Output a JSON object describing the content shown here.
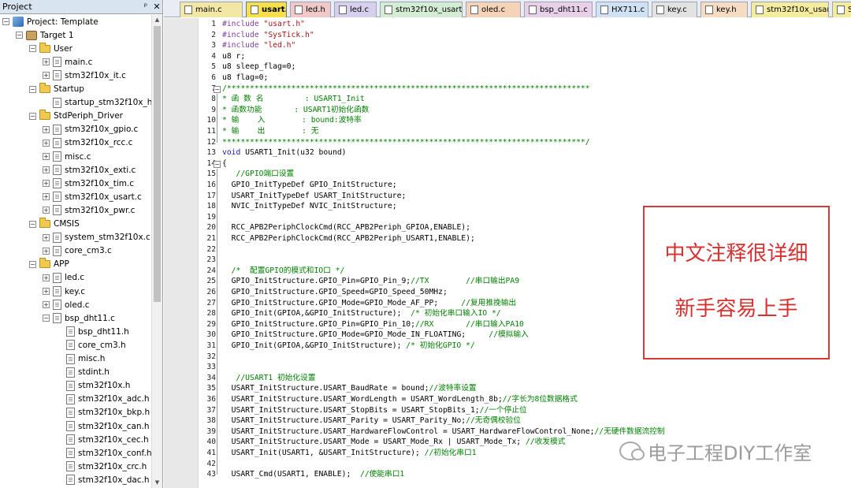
{
  "project_pane": {
    "title": "Project",
    "pin_icon": "pin-icon",
    "close_icon": "close-icon"
  },
  "tree": [
    {
      "label": "Project: Template",
      "indent": 0,
      "kind": "proj",
      "toggle": "-"
    },
    {
      "label": "Target 1",
      "indent": 1,
      "kind": "target",
      "toggle": "-"
    },
    {
      "label": "User",
      "indent": 2,
      "kind": "folder",
      "toggle": "-"
    },
    {
      "label": "main.c",
      "indent": 3,
      "kind": "file",
      "toggle": "+"
    },
    {
      "label": "stm32f10x_it.c",
      "indent": 3,
      "kind": "file",
      "toggle": "+"
    },
    {
      "label": "Startup",
      "indent": 2,
      "kind": "folder",
      "toggle": "-"
    },
    {
      "label": "startup_stm32f10x_hd.s",
      "indent": 3,
      "kind": "file",
      "toggle": ""
    },
    {
      "label": "StdPeriph_Driver",
      "indent": 2,
      "kind": "folder",
      "toggle": "-"
    },
    {
      "label": "stm32f10x_gpio.c",
      "indent": 3,
      "kind": "file",
      "toggle": "+"
    },
    {
      "label": "stm32f10x_rcc.c",
      "indent": 3,
      "kind": "file",
      "toggle": "+"
    },
    {
      "label": "misc.c",
      "indent": 3,
      "kind": "file",
      "toggle": "+"
    },
    {
      "label": "stm32f10x_exti.c",
      "indent": 3,
      "kind": "file",
      "toggle": "+"
    },
    {
      "label": "stm32f10x_tim.c",
      "indent": 3,
      "kind": "file",
      "toggle": "+"
    },
    {
      "label": "stm32f10x_usart.c",
      "indent": 3,
      "kind": "file",
      "toggle": "+"
    },
    {
      "label": "stm32f10x_pwr.c",
      "indent": 3,
      "kind": "file",
      "toggle": "+"
    },
    {
      "label": "CMSIS",
      "indent": 2,
      "kind": "folder",
      "toggle": "-"
    },
    {
      "label": "system_stm32f10x.c",
      "indent": 3,
      "kind": "file",
      "toggle": "+"
    },
    {
      "label": "core_cm3.c",
      "indent": 3,
      "kind": "file",
      "toggle": "+"
    },
    {
      "label": "APP",
      "indent": 2,
      "kind": "folder",
      "toggle": "-"
    },
    {
      "label": "led.c",
      "indent": 3,
      "kind": "file",
      "toggle": "+"
    },
    {
      "label": "key.c",
      "indent": 3,
      "kind": "file",
      "toggle": "+"
    },
    {
      "label": "oled.c",
      "indent": 3,
      "kind": "file",
      "toggle": "+"
    },
    {
      "label": "bsp_dht11.c",
      "indent": 3,
      "kind": "file",
      "toggle": "-"
    },
    {
      "label": "bsp_dht11.h",
      "indent": 4,
      "kind": "file",
      "toggle": ""
    },
    {
      "label": "core_cm3.h",
      "indent": 4,
      "kind": "file",
      "toggle": ""
    },
    {
      "label": "misc.h",
      "indent": 4,
      "kind": "file",
      "toggle": ""
    },
    {
      "label": "stdint.h",
      "indent": 4,
      "kind": "file",
      "toggle": ""
    },
    {
      "label": "stm32f10x.h",
      "indent": 4,
      "kind": "file",
      "toggle": ""
    },
    {
      "label": "stm32f10x_adc.h",
      "indent": 4,
      "kind": "file",
      "toggle": ""
    },
    {
      "label": "stm32f10x_bkp.h",
      "indent": 4,
      "kind": "file",
      "toggle": ""
    },
    {
      "label": "stm32f10x_can.h",
      "indent": 4,
      "kind": "file",
      "toggle": ""
    },
    {
      "label": "stm32f10x_cec.h",
      "indent": 4,
      "kind": "file",
      "toggle": ""
    },
    {
      "label": "stm32f10x_conf.h",
      "indent": 4,
      "kind": "file",
      "toggle": ""
    },
    {
      "label": "stm32f10x_crc.h",
      "indent": 4,
      "kind": "file",
      "toggle": ""
    },
    {
      "label": "stm32f10x_dac.h",
      "indent": 4,
      "kind": "file",
      "toggle": ""
    }
  ],
  "tabs": [
    {
      "label": "main.c",
      "color": "#f3e7a6",
      "active": false
    },
    {
      "label": "usart.c",
      "color": "#f7e04a",
      "active": true
    },
    {
      "label": "led.h",
      "color": "#f0c8c8",
      "active": false
    },
    {
      "label": "led.c",
      "color": "#d6d0ec",
      "active": false
    },
    {
      "label": "stm32f10x_usart.h",
      "color": "#d4ecd4",
      "active": false
    },
    {
      "label": "oled.c",
      "color": "#f5d3b8",
      "active": false
    },
    {
      "label": "bsp_dht11.c",
      "color": "#e8d0e8",
      "active": false
    },
    {
      "label": "HX711.c",
      "color": "#cfe1f3",
      "active": false
    },
    {
      "label": "key.c",
      "color": "#e2e2e2",
      "active": false
    },
    {
      "label": "key.h",
      "color": "#f5dcc2",
      "active": false
    },
    {
      "label": "stm32f10x_usart.c",
      "color": "#f3ec9e",
      "active": false
    },
    {
      "label": "S",
      "color": "#f3ec9e",
      "active": false
    }
  ],
  "code": [
    {
      "n": "1",
      "html": "<span class=\"pp\">#include</span> <span class=\"str\">\"usart.h\"</span>"
    },
    {
      "n": "2",
      "html": "<span class=\"pp\">#include</span> <span class=\"str\">\"SysTick.h\"</span>"
    },
    {
      "n": "3",
      "html": "<span class=\"pp\">#include</span> <span class=\"str\">\"led.h\"</span>"
    },
    {
      "n": "4",
      "html": "u8 r;"
    },
    {
      "n": "5",
      "html": "u8 sleep_flag=0;"
    },
    {
      "n": "6",
      "html": "u8 flag=0;"
    },
    {
      "n": "7",
      "html": "<span class=\"cm\">/*******************************************************************************</span>"
    },
    {
      "n": "8",
      "html": "<span class=\"cm\">* 函 数 名         : USART1_Init</span>"
    },
    {
      "n": "9",
      "html": "<span class=\"cm\">* 函数功能       : USART1初始化函数</span>"
    },
    {
      "n": "10",
      "html": "<span class=\"cm\">* 输    入        : bound:波特率</span>"
    },
    {
      "n": "11",
      "html": "<span class=\"cm\">* 输    出        : 无</span>"
    },
    {
      "n": "12",
      "html": "<span class=\"cm\">*******************************************************************************/</span>"
    },
    {
      "n": "13",
      "html": "<span class=\"kw\">void</span> USART1_Init(u32 bound)"
    },
    {
      "n": "14",
      "html": "{"
    },
    {
      "n": "15",
      "html": "   <span class=\"cm\">//GPIO端口设置</span>"
    },
    {
      "n": "16",
      "html": "  GPIO_InitTypeDef GPIO_InitStructure;"
    },
    {
      "n": "17",
      "html": "  USART_InitTypeDef USART_InitStructure;"
    },
    {
      "n": "18",
      "html": "  NVIC_InitTypeDef NVIC_InitStructure;"
    },
    {
      "n": "19",
      "html": ""
    },
    {
      "n": "20",
      "html": "  RCC_APB2PeriphClockCmd(RCC_APB2Periph_GPIOA,ENABLE);"
    },
    {
      "n": "21",
      "html": "  RCC_APB2PeriphClockCmd(RCC_APB2Periph_USART1,ENABLE);"
    },
    {
      "n": "22",
      "html": ""
    },
    {
      "n": "23",
      "html": ""
    },
    {
      "n": "24",
      "html": "  <span class=\"cm\">/*  配置GPIO的模式和IO口 */</span>"
    },
    {
      "n": "25",
      "html": "  GPIO_InitStructure.GPIO_Pin=GPIO_Pin_9;<span class=\"cm\">//TX        //串口输出PA9</span>"
    },
    {
      "n": "26",
      "html": "  GPIO_InitStructure.GPIO_Speed=GPIO_Speed_50MHz;"
    },
    {
      "n": "27",
      "html": "  GPIO_InitStructure.GPIO_Mode=GPIO_Mode_AF_PP;     <span class=\"cm\">//复用推挽输出</span>"
    },
    {
      "n": "28",
      "html": "  GPIO_Init(GPIOA,&amp;GPIO_InitStructure);  <span class=\"cm\">/* 初始化串口输入IO */</span>"
    },
    {
      "n": "29",
      "html": "  GPIO_InitStructure.GPIO_Pin=GPIO_Pin_10;<span class=\"cm\">//RX       //串口输入PA10</span>"
    },
    {
      "n": "30",
      "html": "  GPIO_InitStructure.GPIO_Mode=GPIO_Mode_IN_FLOATING;     <span class=\"cm\">//模拟输入</span>"
    },
    {
      "n": "31",
      "html": "  GPIO_Init(GPIOA,&amp;GPIO_InitStructure); <span class=\"cm\">/* 初始化GPIO */</span>"
    },
    {
      "n": "32",
      "html": ""
    },
    {
      "n": "33",
      "html": ""
    },
    {
      "n": "34",
      "html": "   <span class=\"cm\">//USART1 初始化设置</span>"
    },
    {
      "n": "35",
      "html": "  USART_InitStructure.USART_BaudRate = bound;<span class=\"cm\">//波特率设置</span>"
    },
    {
      "n": "36",
      "html": "  USART_InitStructure.USART_WordLength = USART_WordLength_8b;<span class=\"cm\">//字长为8位数据格式</span>"
    },
    {
      "n": "37",
      "html": "  USART_InitStructure.USART_StopBits = USART_StopBits_1;<span class=\"cm\">//一个停止位</span>"
    },
    {
      "n": "38",
      "html": "  USART_InitStructure.USART_Parity = USART_Parity_No;<span class=\"cm\">//无奇偶校验位</span>"
    },
    {
      "n": "39",
      "html": "  USART_InitStructure.USART_HardwareFlowControl = USART_HardwareFlowControl_None;<span class=\"cm\">//无硬件数据流控制</span>"
    },
    {
      "n": "40",
      "html": "  USART_InitStructure.USART_Mode = USART_Mode_Rx | USART_Mode_Tx; <span class=\"cm\">//收发模式</span>"
    },
    {
      "n": "41",
      "html": "  USART_Init(USART1, &amp;USART_InitStructure); <span class=\"cm\">//初始化串口1</span>"
    },
    {
      "n": "42",
      "html": ""
    },
    {
      "n": "43",
      "html": "  USART_Cmd(USART1, ENABLE);  <span class=\"cm\">//使能串口1</span>"
    }
  ],
  "annotation": {
    "line1": "中文注释很详细",
    "line2": "新手容易上手"
  },
  "watermark": {
    "text": "电子工程DIY工作室",
    "icon": "wechat-icon"
  },
  "colors": {
    "accent_red": "#d8302f",
    "comment_green": "#008000"
  }
}
